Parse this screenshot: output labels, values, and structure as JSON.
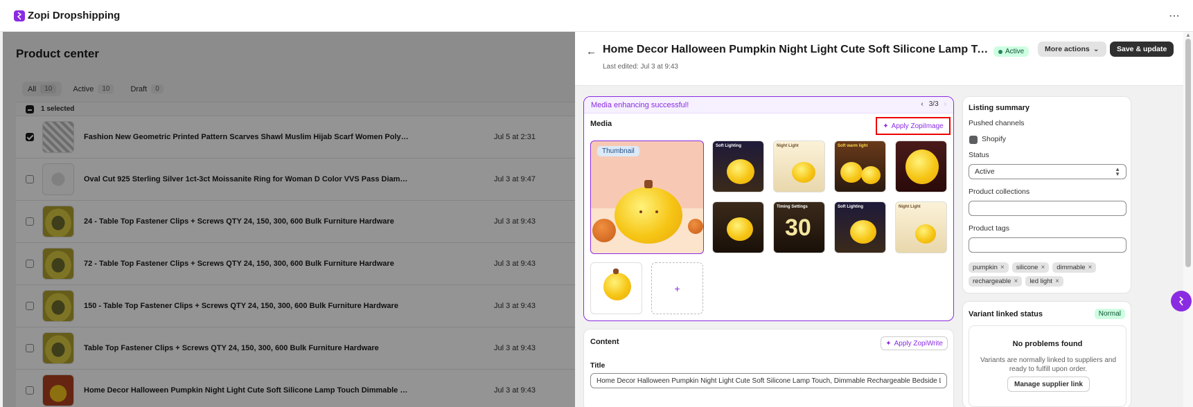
{
  "app": {
    "title": "Zopi Dropshipping"
  },
  "left": {
    "page_title": "Product center",
    "filters": [
      {
        "label": "All",
        "count": "10"
      },
      {
        "label": "Active",
        "count": "10"
      },
      {
        "label": "Draft",
        "count": "0"
      }
    ],
    "selected_text": "1 selected",
    "rows": [
      {
        "title": "Fashion New Geometric Printed Pattern Scarves Shawl Muslim Hijab Scarf Women Polyester Headscarf",
        "date": "Jul 5 at 2:31"
      },
      {
        "title": "Oval Cut 925 Sterling Silver 1ct-3ct Moissanite Ring for Woman D Color VVS Pass Diamond Tester",
        "date": "Jul 3 at 9:47"
      },
      {
        "title": "24 - Table Top Fastener Clips + Screws QTY 24, 150, 300, 600 Bulk Furniture Hardware",
        "date": "Jul 3 at 9:43"
      },
      {
        "title": "72 - Table Top Fastener Clips + Screws QTY 24, 150, 300, 600 Bulk Furniture Hardware",
        "date": "Jul 3 at 9:43"
      },
      {
        "title": "150 - Table Top Fastener Clips + Screws QTY 24, 150, 300, 600 Bulk Furniture Hardware",
        "date": "Jul 3 at 9:43"
      },
      {
        "title": "Table Top Fastener Clips + Screws QTY 24, 150, 300, 600 Bulk Furniture Hardware",
        "date": "Jul 3 at 9:43"
      },
      {
        "title": "Home Decor Halloween Pumpkin Night Light Cute Soft Silicone Lamp Touch Dimmable Rechargeable",
        "date": "Jul 3 at 9:43"
      }
    ]
  },
  "panel": {
    "title": "Home Decor Halloween Pumpkin Night Light Cute Soft Silicone Lamp Touch Dimmable Rechargeable",
    "last_edited": "Last edited: Jul 3 at 9:43",
    "status_badge": "Active",
    "more_actions": "More actions",
    "save_update": "Save & update",
    "media": {
      "banner": "Media enhancing successful!",
      "pager": "3/3",
      "label": "Media",
      "apply_button": "Apply ZopiImage",
      "thumbnail_tag": "Thumbnail",
      "tile_captions": [
        "Soft Lighting",
        "Night Light",
        "Soft warm light",
        "",
        "",
        "Timing Settings",
        "Soft Lighting",
        "Night Light"
      ],
      "timer_number": "30",
      "add_symbol": "+"
    },
    "content": {
      "label": "Content",
      "apply_write": "Apply ZopiWrite",
      "title_label": "Title",
      "title_value": "Home Decor Halloween Pumpkin Night Light Cute Soft Silicone Lamp Touch, Dimmable Rechargeable Bedside Lamp"
    },
    "listing": {
      "heading": "Listing summary",
      "pushed_channels": "Pushed channels",
      "channel": "Shopify",
      "status_label": "Status",
      "status_value": "Active",
      "collections_label": "Product collections",
      "tags_label": "Product tags",
      "tags": [
        "pumpkin",
        "silicone",
        "dimmable",
        "rechargeable",
        "led light"
      ]
    },
    "variant": {
      "heading": "Variant linked status",
      "badge": "Normal",
      "np_title": "No problems found",
      "np_desc": "Variants are normally linked to suppliers and ready to fulfill upon order.",
      "np_button": "Manage supplier link"
    }
  },
  "colors": {
    "accent": "#8a2be2",
    "success_bg": "#cdfee1",
    "highlight": "#ee0000"
  }
}
